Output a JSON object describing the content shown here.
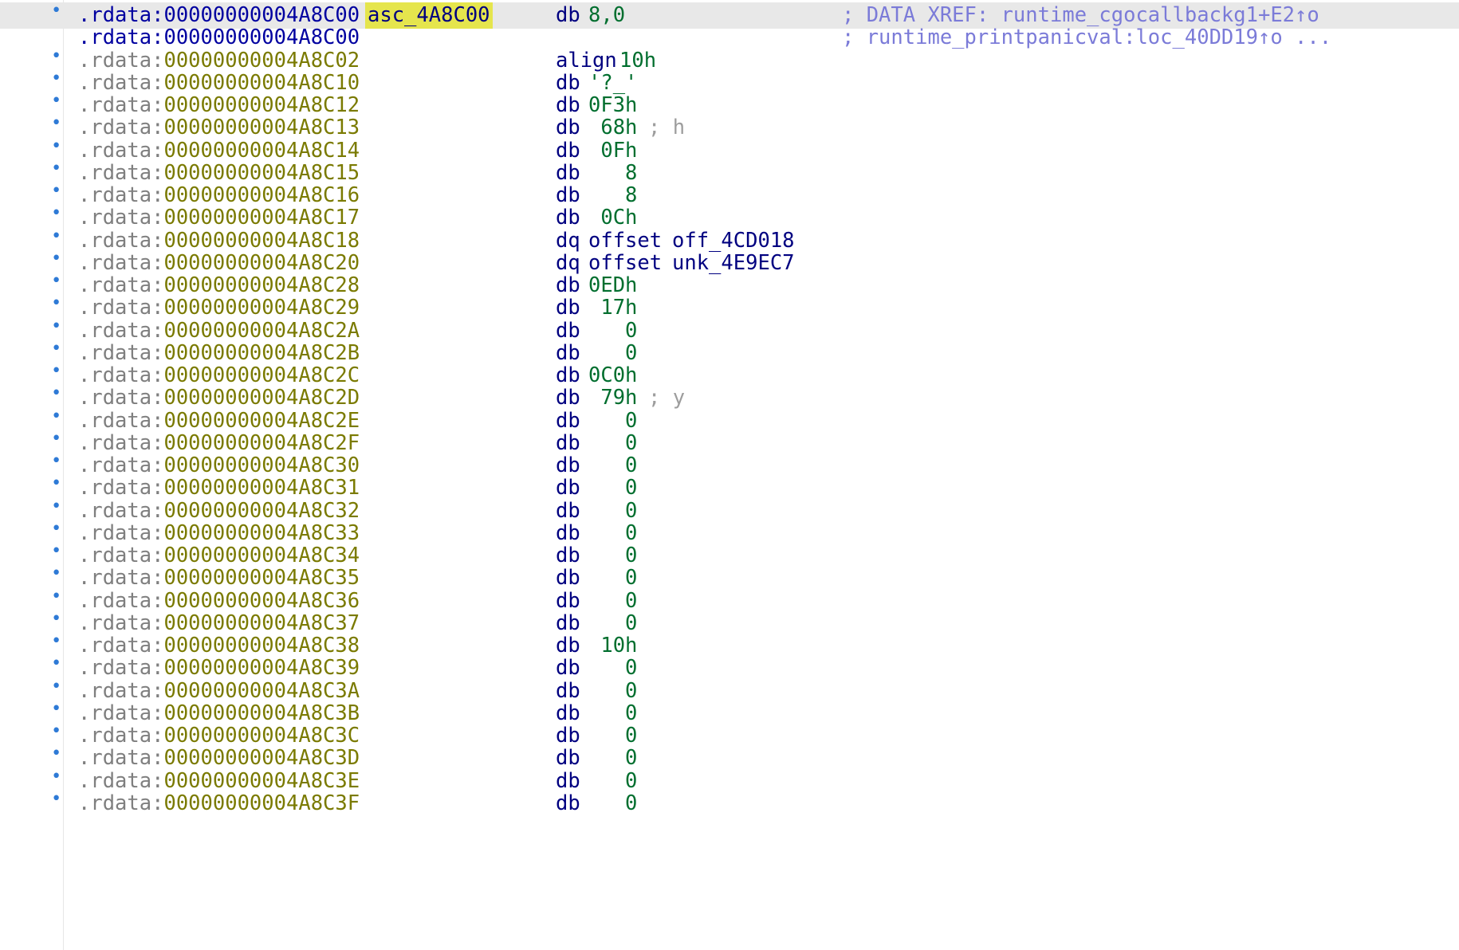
{
  "listing": {
    "lines": [
      {
        "seg": ".rdata:",
        "offset": "00000000004A8C00",
        "label": "asc_4A8C00",
        "mnem": "db",
        "operand": "8,0",
        "xref": "; DATA XREF: runtime_cgocallbackg1+E2↑o"
      },
      {
        "seg": ".rdata:",
        "offset": "00000000004A8C00",
        "xref": "; runtime_printpanicval:loc_40DD19↑o ..."
      },
      {
        "seg": ".rdata:",
        "offset": "00000000004A8C02",
        "mnem": "align",
        "operand": "10h"
      },
      {
        "seg": ".rdata:",
        "offset": "00000000004A8C10",
        "mnem": "db",
        "operand": "'?_'"
      },
      {
        "seg": ".rdata:",
        "offset": "00000000004A8C12",
        "mnem": "db",
        "operand": "0F3h"
      },
      {
        "seg": ".rdata:",
        "offset": "00000000004A8C13",
        "mnem": "db",
        "operand": " 68h",
        "comment": "; h"
      },
      {
        "seg": ".rdata:",
        "offset": "00000000004A8C14",
        "mnem": "db",
        "operand": " 0Fh"
      },
      {
        "seg": ".rdata:",
        "offset": "00000000004A8C15",
        "mnem": "db",
        "operand": "   8"
      },
      {
        "seg": ".rdata:",
        "offset": "00000000004A8C16",
        "mnem": "db",
        "operand": "   8"
      },
      {
        "seg": ".rdata:",
        "offset": "00000000004A8C17",
        "mnem": "db",
        "operand": " 0Ch"
      },
      {
        "seg": ".rdata:",
        "offset": "00000000004A8C18",
        "mnem": "dq",
        "operand": "offset",
        "name": "off_4CD018"
      },
      {
        "seg": ".rdata:",
        "offset": "00000000004A8C20",
        "mnem": "dq",
        "operand": "offset",
        "name": "unk_4E9EC7"
      },
      {
        "seg": ".rdata:",
        "offset": "00000000004A8C28",
        "mnem": "db",
        "operand": "0EDh"
      },
      {
        "seg": ".rdata:",
        "offset": "00000000004A8C29",
        "mnem": "db",
        "operand": " 17h"
      },
      {
        "seg": ".rdata:",
        "offset": "00000000004A8C2A",
        "mnem": "db",
        "operand": "   0"
      },
      {
        "seg": ".rdata:",
        "offset": "00000000004A8C2B",
        "mnem": "db",
        "operand": "   0"
      },
      {
        "seg": ".rdata:",
        "offset": "00000000004A8C2C",
        "mnem": "db",
        "operand": "0C0h"
      },
      {
        "seg": ".rdata:",
        "offset": "00000000004A8C2D",
        "mnem": "db",
        "operand": " 79h",
        "comment": "; y"
      },
      {
        "seg": ".rdata:",
        "offset": "00000000004A8C2E",
        "mnem": "db",
        "operand": "   0"
      },
      {
        "seg": ".rdata:",
        "offset": "00000000004A8C2F",
        "mnem": "db",
        "operand": "   0"
      },
      {
        "seg": ".rdata:",
        "offset": "00000000004A8C30",
        "mnem": "db",
        "operand": "   0"
      },
      {
        "seg": ".rdata:",
        "offset": "00000000004A8C31",
        "mnem": "db",
        "operand": "   0"
      },
      {
        "seg": ".rdata:",
        "offset": "00000000004A8C32",
        "mnem": "db",
        "operand": "   0"
      },
      {
        "seg": ".rdata:",
        "offset": "00000000004A8C33",
        "mnem": "db",
        "operand": "   0"
      },
      {
        "seg": ".rdata:",
        "offset": "00000000004A8C34",
        "mnem": "db",
        "operand": "   0"
      },
      {
        "seg": ".rdata:",
        "offset": "00000000004A8C35",
        "mnem": "db",
        "operand": "   0"
      },
      {
        "seg": ".rdata:",
        "offset": "00000000004A8C36",
        "mnem": "db",
        "operand": "   0"
      },
      {
        "seg": ".rdata:",
        "offset": "00000000004A8C37",
        "mnem": "db",
        "operand": "   0"
      },
      {
        "seg": ".rdata:",
        "offset": "00000000004A8C38",
        "mnem": "db",
        "operand": " 10h"
      },
      {
        "seg": ".rdata:",
        "offset": "00000000004A8C39",
        "mnem": "db",
        "operand": "   0"
      },
      {
        "seg": ".rdata:",
        "offset": "00000000004A8C3A",
        "mnem": "db",
        "operand": "   0"
      },
      {
        "seg": ".rdata:",
        "offset": "00000000004A8C3B",
        "mnem": "db",
        "operand": "   0"
      },
      {
        "seg": ".rdata:",
        "offset": "00000000004A8C3C",
        "mnem": "db",
        "operand": "   0"
      },
      {
        "seg": ".rdata:",
        "offset": "00000000004A8C3D",
        "mnem": "db",
        "operand": "   0"
      },
      {
        "seg": ".rdata:",
        "offset": "00000000004A8C3E",
        "mnem": "db",
        "operand": "   0"
      },
      {
        "seg": ".rdata:",
        "offset": "00000000004A8C3F",
        "mnem": "db",
        "operand": "   0"
      }
    ]
  },
  "colors": {
    "current_line_bg": "#e8e8e8",
    "label_highlight": "#e5e54d",
    "address_blue": "#0000a0",
    "address_olive": "#7a7a00",
    "mnemonic": "#000080",
    "operand_green": "#006e2e",
    "xref_comment": "#7b7bd8",
    "comment_gray": "#9d9d9d",
    "gutter_bullet": "#2e7ad6"
  },
  "icons": {
    "gutter_marker": "bullet-dot-icon"
  }
}
